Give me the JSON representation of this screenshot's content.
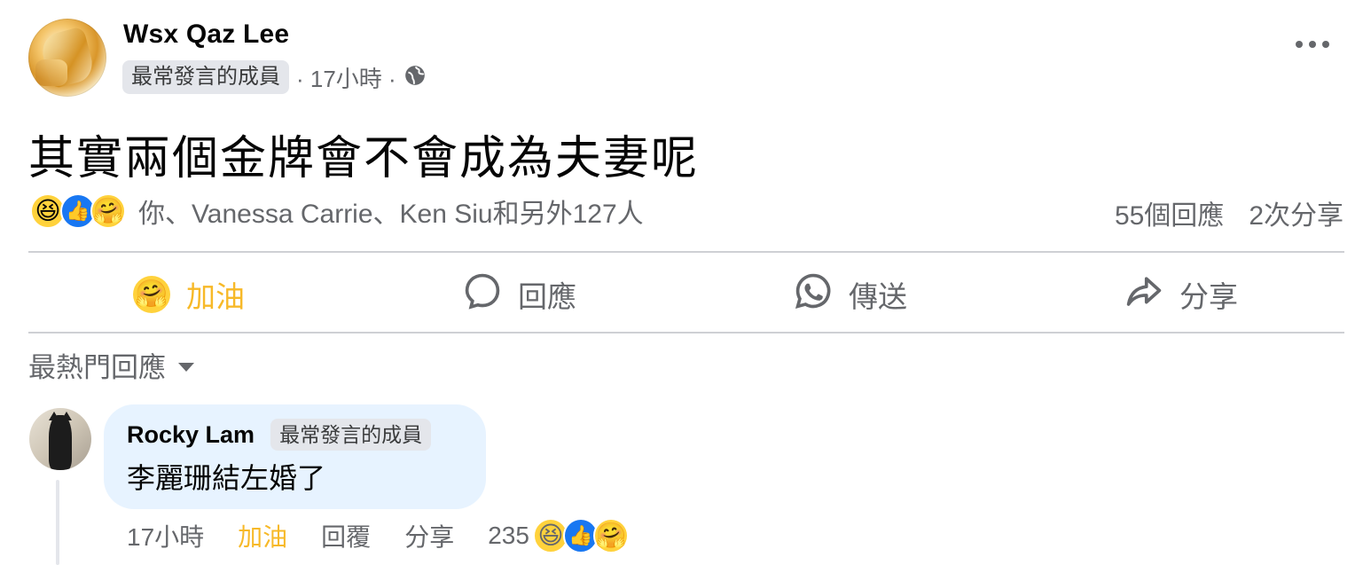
{
  "post": {
    "author": "Wsx Qaz Lee",
    "badge": "最常發言的成員",
    "time": "· 17小時 ·",
    "text": "其實兩個金牌會不會成為夫妻呢",
    "reactions_text": "你、Vanessa Carrie、Ken Siu和另外127人",
    "comments_count": "55個回應",
    "shares_count": "2次分享",
    "reaction_icons": [
      "haha",
      "like",
      "care"
    ]
  },
  "actions": {
    "care": "加油",
    "comment": "回應",
    "send": "傳送",
    "share": "分享"
  },
  "sort": {
    "label": "最熱門回應"
  },
  "comment": {
    "author": "Rocky Lam",
    "badge": "最常發言的成員",
    "text": "李麗珊結左婚了",
    "time": "17小時",
    "care": "加油",
    "reply": "回覆",
    "share": "分享",
    "reaction_count": "235"
  },
  "colors": {
    "accent_care": "#f7b928",
    "meta_gray": "#65676b",
    "bubble_bg": "#e7f3ff",
    "like_blue": "#1877f2"
  }
}
